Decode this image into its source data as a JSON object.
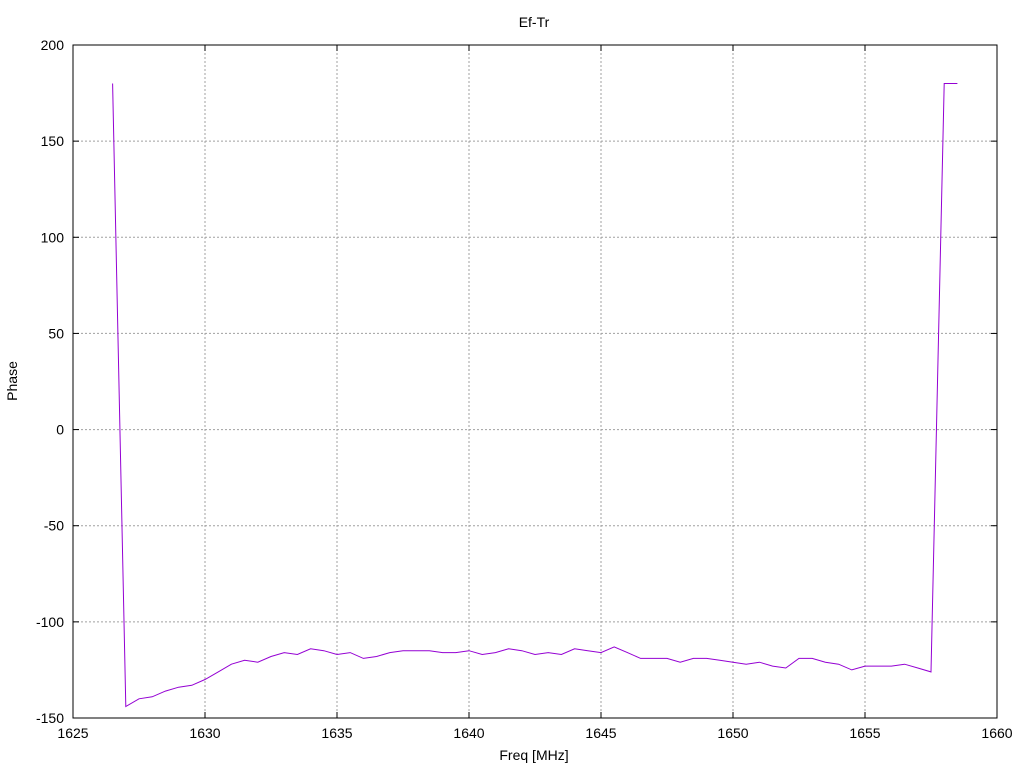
{
  "chart_data": {
    "type": "line",
    "title": "Ef-Tr",
    "xlabel": "Freq [MHz]",
    "ylabel": "Phase",
    "xlim": [
      1625,
      1660
    ],
    "ylim": [
      -150,
      200
    ],
    "xticks": [
      1625,
      1630,
      1635,
      1640,
      1645,
      1650,
      1655,
      1660
    ],
    "yticks": [
      -150,
      -100,
      -50,
      0,
      50,
      100,
      150,
      200
    ],
    "grid": true,
    "grid_style": "dotted",
    "series": [
      {
        "color": "#9400d3",
        "x": [
          1626.5,
          1627.0,
          1627.5,
          1628.0,
          1628.5,
          1629.0,
          1629.5,
          1630.0,
          1630.5,
          1631.0,
          1631.5,
          1632.0,
          1632.5,
          1633.0,
          1633.5,
          1634.0,
          1634.5,
          1635.0,
          1635.5,
          1636.0,
          1636.5,
          1637.0,
          1637.5,
          1638.0,
          1638.5,
          1639.0,
          1639.5,
          1640.0,
          1640.5,
          1641.0,
          1641.5,
          1642.0,
          1642.5,
          1643.0,
          1643.5,
          1644.0,
          1644.5,
          1645.0,
          1645.5,
          1646.0,
          1646.5,
          1647.0,
          1647.5,
          1648.0,
          1648.5,
          1649.0,
          1649.5,
          1650.0,
          1650.5,
          1651.0,
          1651.5,
          1652.0,
          1652.5,
          1653.0,
          1653.5,
          1654.0,
          1654.5,
          1655.0,
          1655.5,
          1656.0,
          1656.5,
          1657.0,
          1657.5,
          1658.0,
          1658.5
        ],
        "y": [
          180,
          -144,
          -140,
          -139,
          -136,
          -134,
          -133,
          -130,
          -126,
          -122,
          -120,
          -121,
          -118,
          -116,
          -117,
          -114,
          -115,
          -117,
          -116,
          -119,
          -118,
          -116,
          -115,
          -115,
          -115,
          -116,
          -116,
          -115,
          -117,
          -116,
          -114,
          -115,
          -117,
          -116,
          -117,
          -114,
          -115,
          -116,
          -113,
          -116,
          -119,
          -119,
          -119,
          -121,
          -119,
          -119,
          -120,
          -121,
          -122,
          -121,
          -123,
          -124,
          -119,
          -119,
          -121,
          -122,
          -125,
          -123,
          -123,
          -123,
          -122,
          -124,
          -126,
          180,
          180
        ]
      }
    ]
  }
}
